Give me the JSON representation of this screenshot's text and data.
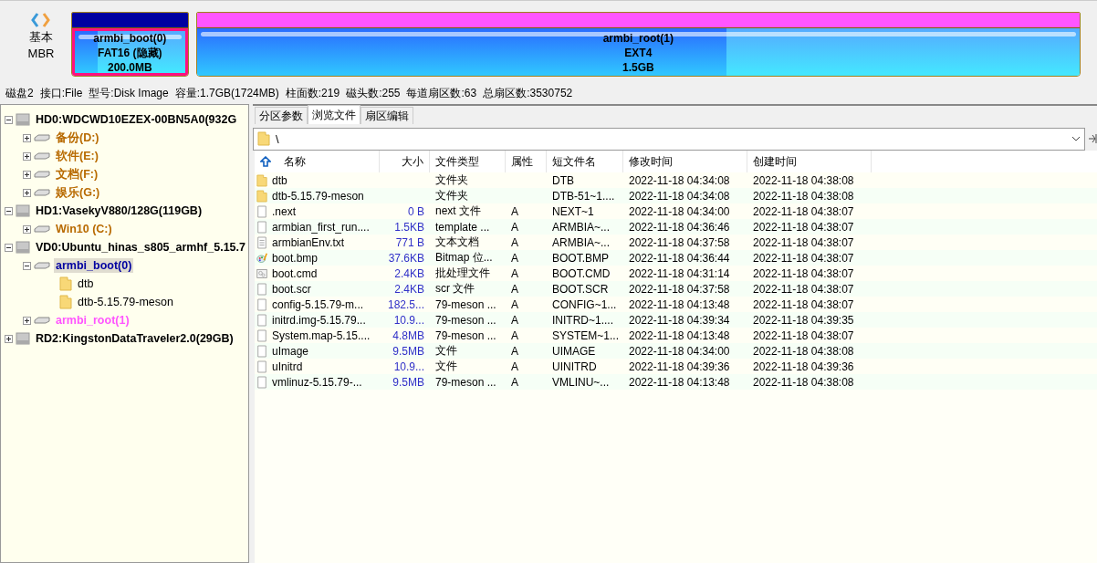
{
  "disk_map": {
    "disk_type": "基本",
    "scheme": "MBR",
    "partitions": [
      {
        "name": "armbi_boot(0)",
        "filesystem": "FAT16 (隐藏)",
        "size": "200.0MB",
        "color": "#0000a0",
        "level": 0.21,
        "selected": true
      },
      {
        "name": "armbi_root(1)",
        "filesystem": "EXT4",
        "size": "1.5GB",
        "color": "#ff55ff",
        "level": 0.6,
        "selected": false
      }
    ]
  },
  "disk_info": [
    "磁盘2",
    "接口:File",
    "型号:Disk Image",
    "容量:1.7GB(1724MB)",
    "柱面数:219",
    "磁头数:255",
    "每道扇区数:63",
    "总扇区数:3530752"
  ],
  "tree": [
    {
      "kind": "disk",
      "label": "HD0:WDCWD10EZEX-00BN5A0(932G",
      "expanded": true,
      "children": [
        {
          "kind": "partition",
          "label": "备份(D:)",
          "color": "#b86a00",
          "expanded": false,
          "selected": false
        },
        {
          "kind": "partition",
          "label": "软件(E:)",
          "color": "#b86a00",
          "expanded": false,
          "selected": false
        },
        {
          "kind": "partition",
          "label": "文档(F:)",
          "color": "#b86a00",
          "expanded": false,
          "selected": false
        },
        {
          "kind": "partition",
          "label": "娱乐(G:)",
          "color": "#b86a00",
          "expanded": false,
          "selected": false
        }
      ]
    },
    {
      "kind": "disk",
      "label": "HD1:VasekyV880/128G(119GB)",
      "expanded": true,
      "children": [
        {
          "kind": "partition",
          "label": "Win10 (C:)",
          "color": "#b86a00",
          "expanded": false,
          "selected": false
        }
      ]
    },
    {
      "kind": "disk",
      "label": "VD0:Ubuntu_hinas_s805_armhf_5.15.7",
      "expanded": true,
      "children": [
        {
          "kind": "partition",
          "label": "armbi_boot(0)",
          "color": "#0000a0",
          "expanded": true,
          "selected": true,
          "children": [
            {
              "kind": "folder",
              "label": "dtb"
            },
            {
              "kind": "folder",
              "label": "dtb-5.15.79-meson"
            }
          ]
        },
        {
          "kind": "partition",
          "label": "armbi_root(1)",
          "color": "#ff55ff",
          "expanded": false,
          "selected": false
        }
      ]
    },
    {
      "kind": "disk",
      "label": "RD2:KingstonDataTraveler2.0(29GB)",
      "expanded": false
    }
  ],
  "tabs": [
    {
      "label": "分区参数",
      "selected": false
    },
    {
      "label": "浏览文件",
      "selected": true
    },
    {
      "label": "扇区编辑",
      "selected": false
    }
  ],
  "path": "\\",
  "columns": [
    "名称",
    "大小",
    "文件类型",
    "属性",
    "短文件名",
    "修改时间",
    "创建时间"
  ],
  "files": [
    {
      "kind": "folder",
      "name": "dtb",
      "type": "文件夹",
      "short": "DTB",
      "modified": "2022-11-18 04:34:08",
      "created": "2022-11-18 04:38:08"
    },
    {
      "kind": "folder",
      "name": "dtb-5.15.79-meson",
      "type": "文件夹",
      "short": "DTB-51~1....",
      "modified": "2022-11-18 04:34:08",
      "created": "2022-11-18 04:38:08"
    },
    {
      "kind": "file",
      "name": ".next",
      "size": "0 B",
      "type": "next 文件",
      "attr": "A",
      "short": "NEXT~1",
      "modified": "2022-11-18 04:34:00",
      "created": "2022-11-18 04:38:07"
    },
    {
      "kind": "file",
      "name": "armbian_first_run....",
      "size": "1.5KB",
      "type": "template ...",
      "attr": "A",
      "short": "ARMBIA~...",
      "modified": "2022-11-18 04:36:46",
      "created": "2022-11-18 04:38:07"
    },
    {
      "kind": "text",
      "name": "armbianEnv.txt",
      "size": "771 B",
      "type": "文本文档",
      "attr": "A",
      "short": "ARMBIA~...",
      "modified": "2022-11-18 04:37:58",
      "created": "2022-11-18 04:38:07"
    },
    {
      "kind": "image",
      "name": "boot.bmp",
      "size": "37.6KB",
      "type": "Bitmap 位...",
      "attr": "A",
      "short": "BOOT.BMP",
      "modified": "2022-11-18 04:36:44",
      "created": "2022-11-18 04:38:07"
    },
    {
      "kind": "script",
      "name": "boot.cmd",
      "size": "2.4KB",
      "type": "批处理文件",
      "attr": "A",
      "short": "BOOT.CMD",
      "modified": "2022-11-18 04:31:14",
      "created": "2022-11-18 04:38:07"
    },
    {
      "kind": "file",
      "name": "boot.scr",
      "size": "2.4KB",
      "type": "scr 文件",
      "attr": "A",
      "short": "BOOT.SCR",
      "modified": "2022-11-18 04:37:58",
      "created": "2022-11-18 04:38:07"
    },
    {
      "kind": "file",
      "name": "config-5.15.79-m...",
      "size": "182.5...",
      "type": "79-meson ...",
      "attr": "A",
      "short": "CONFIG~1...",
      "modified": "2022-11-18 04:13:48",
      "created": "2022-11-18 04:38:07"
    },
    {
      "kind": "file",
      "name": "initrd.img-5.15.79...",
      "size": "10.9...",
      "type": "79-meson ...",
      "attr": "A",
      "short": "INITRD~1....",
      "modified": "2022-11-18 04:39:34",
      "created": "2022-11-18 04:39:35"
    },
    {
      "kind": "file",
      "name": "System.map-5.15....",
      "size": "4.8MB",
      "type": "79-meson ...",
      "attr": "A",
      "short": "SYSTEM~1...",
      "modified": "2022-11-18 04:13:48",
      "created": "2022-11-18 04:38:07"
    },
    {
      "kind": "file",
      "name": "uImage",
      "size": "9.5MB",
      "type": "文件",
      "attr": "A",
      "short": "UIMAGE",
      "modified": "2022-11-18 04:34:00",
      "created": "2022-11-18 04:38:08"
    },
    {
      "kind": "file",
      "name": "uInitrd",
      "size": "10.9...",
      "type": "文件",
      "attr": "A",
      "short": "UINITRD",
      "modified": "2022-11-18 04:39:36",
      "created": "2022-11-18 04:39:36"
    },
    {
      "kind": "file",
      "name": "vmlinuz-5.15.79-...",
      "size": "9.5MB",
      "type": "79-meson ...",
      "attr": "A",
      "short": "VMLINU~...",
      "modified": "2022-11-18 04:13:48",
      "created": "2022-11-18 04:38:08"
    }
  ]
}
